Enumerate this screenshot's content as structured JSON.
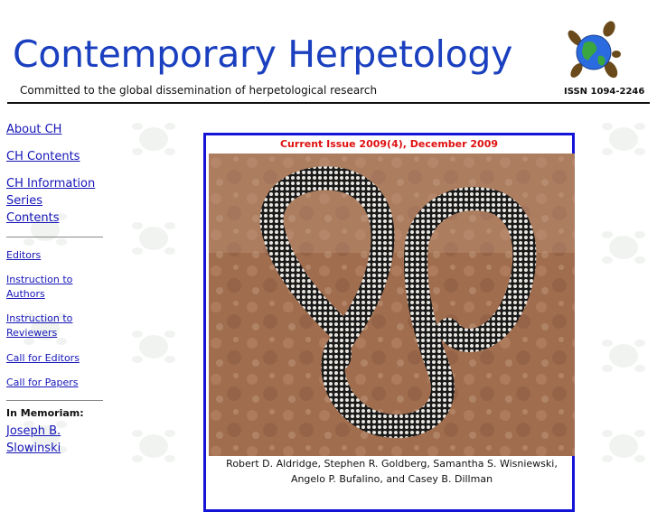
{
  "header": {
    "title": "Contemporary Herpetology",
    "tagline": "Committed to the global dissemination of herpetological research",
    "issn": "ISSN 1094-2246",
    "logo_icon": "turtle-globe-icon"
  },
  "sidebar": {
    "primary": [
      {
        "label": "About CH"
      },
      {
        "label": "CH Contents"
      },
      {
        "label": "CH Information Series Contents"
      }
    ],
    "secondary": [
      {
        "label": "Editors"
      },
      {
        "label": "Instruction to Authors"
      },
      {
        "label": "Instruction to Reviewers"
      },
      {
        "label": "Call for Editors"
      },
      {
        "label": "Call for Papers"
      }
    ],
    "memoriam_heading": "In Memoriam:",
    "memoriam_link": "Joseph B. Slowinski"
  },
  "feature": {
    "issue_label": "Current Issue 2009(4), December 2009",
    "caption": "Robert D. Aldridge, Stephen R. Goldberg, Samantha S. Wisniewski, Angelo P. Bufalino, and Casey B. Dillman",
    "image_icon": "snake-cover-image"
  },
  "colors": {
    "title": "#1a3fbf",
    "link": "#1515b8",
    "issue_label": "#e01010",
    "feature_border": "#1414d6"
  }
}
